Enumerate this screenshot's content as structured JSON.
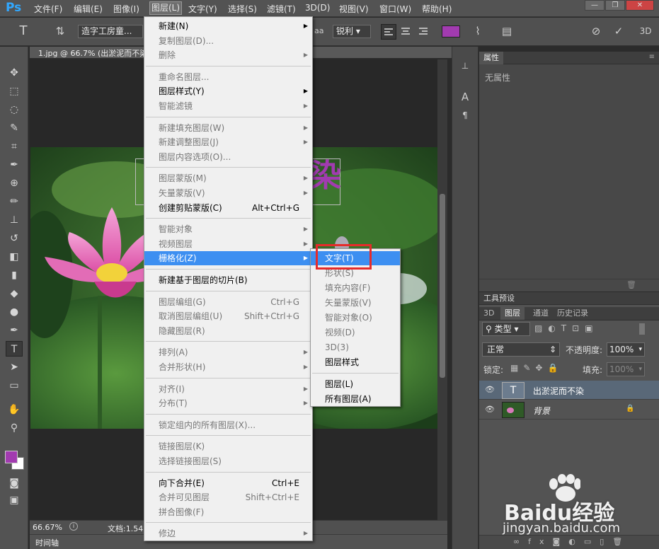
{
  "app": {
    "logo": "Ps"
  },
  "menubar": {
    "items": [
      "文件(F)",
      "编辑(E)",
      "图像(I)",
      "图层(L)",
      "文字(Y)",
      "选择(S)",
      "滤镜(T)",
      "3D(D)",
      "视图(V)",
      "窗口(W)",
      "帮助(H)"
    ],
    "active_index": 3
  },
  "window_controls": {
    "minimize": "—",
    "restore": "❐",
    "close": "✕"
  },
  "options": {
    "tool_glyph": "T",
    "font_family": "造字工房童...",
    "font_size_unit": "aa",
    "antialias": "锐利",
    "text_color": "#a23bb0",
    "d3": "3D"
  },
  "document": {
    "tab_title": "1.jpg @ 66.7% (出淤泥而不染",
    "zoom": "66.67%",
    "doc_info": "文档:1.54",
    "text_overlay": "出淤泥而不染"
  },
  "timeline": {
    "label": "时间轴"
  },
  "toolbar": {
    "tools": [
      "move-tool",
      "marquee-tool",
      "lasso-tool",
      "quick-select-tool",
      "crop-tool",
      "eyedropper-tool",
      "healing-tool",
      "brush-tool",
      "stamp-tool",
      "history-brush-tool",
      "eraser-tool",
      "gradient-tool",
      "blur-tool",
      "dodge-tool",
      "pen-tool",
      "type-tool",
      "path-select-tool",
      "shape-tool",
      "hand-tool",
      "zoom-tool"
    ],
    "foreground": "#a23bb0",
    "background": "#ffffff"
  },
  "properties": {
    "tab": "属性",
    "empty_text": "无属性"
  },
  "tool_presets": {
    "tab": "工具预设"
  },
  "layers_panel": {
    "tabs": [
      "3D",
      "图层",
      "通道",
      "历史记录"
    ],
    "filter_kind": "类型",
    "blend_mode": "正常",
    "opacity_label": "不透明度:",
    "opacity": "100%",
    "lock_label": "锁定:",
    "fill_label": "填充:",
    "fill": "100%",
    "layers": [
      {
        "name": "出淤泥而不染",
        "type": "text",
        "selected": true
      },
      {
        "name": "背景",
        "type": "image",
        "locked": true
      }
    ]
  },
  "layer_menu": {
    "items": [
      {
        "label": "新建(N)",
        "enabled": true,
        "submenu": true
      },
      {
        "label": "复制图层(D)...",
        "enabled": false
      },
      {
        "label": "删除",
        "enabled": false,
        "submenu": true
      },
      {
        "sep": true
      },
      {
        "label": "重命名图层...",
        "enabled": false
      },
      {
        "label": "图层样式(Y)",
        "enabled": true,
        "submenu": true
      },
      {
        "label": "智能滤镜",
        "enabled": false,
        "submenu": true
      },
      {
        "sep": true
      },
      {
        "label": "新建填充图层(W)",
        "enabled": false,
        "submenu": true
      },
      {
        "label": "新建调整图层(J)",
        "enabled": false,
        "submenu": true
      },
      {
        "label": "图层内容选项(O)...",
        "enabled": false
      },
      {
        "sep": true
      },
      {
        "label": "图层蒙版(M)",
        "enabled": false,
        "submenu": true
      },
      {
        "label": "矢量蒙版(V)",
        "enabled": false,
        "submenu": true
      },
      {
        "label": "创建剪贴蒙版(C)",
        "enabled": true,
        "shortcut": "Alt+Ctrl+G"
      },
      {
        "sep": true
      },
      {
        "label": "智能对象",
        "enabled": false,
        "submenu": true
      },
      {
        "label": "视频图层",
        "enabled": false,
        "submenu": true
      },
      {
        "label": "栅格化(Z)",
        "enabled": true,
        "submenu": true,
        "highlight": true
      },
      {
        "sep": true
      },
      {
        "label": "新建基于图层的切片(B)",
        "enabled": true
      },
      {
        "sep": true
      },
      {
        "label": "图层编组(G)",
        "enabled": false,
        "shortcut": "Ctrl+G"
      },
      {
        "label": "取消图层编组(U)",
        "enabled": false,
        "shortcut": "Shift+Ctrl+G"
      },
      {
        "label": "隐藏图层(R)",
        "enabled": false
      },
      {
        "sep": true
      },
      {
        "label": "排列(A)",
        "enabled": false,
        "submenu": true
      },
      {
        "label": "合并形状(H)",
        "enabled": false,
        "submenu": true
      },
      {
        "sep": true
      },
      {
        "label": "对齐(I)",
        "enabled": false,
        "submenu": true
      },
      {
        "label": "分布(T)",
        "enabled": false,
        "submenu": true
      },
      {
        "sep": true
      },
      {
        "label": "锁定组内的所有图层(X)...",
        "enabled": false
      },
      {
        "sep": true
      },
      {
        "label": "链接图层(K)",
        "enabled": false
      },
      {
        "label": "选择链接图层(S)",
        "enabled": false
      },
      {
        "sep": true
      },
      {
        "label": "向下合并(E)",
        "enabled": true,
        "shortcut": "Ctrl+E"
      },
      {
        "label": "合并可见图层",
        "enabled": false,
        "shortcut": "Shift+Ctrl+E"
      },
      {
        "label": "拼合图像(F)",
        "enabled": false
      },
      {
        "sep": true
      },
      {
        "label": "修边",
        "enabled": false,
        "submenu": true
      }
    ]
  },
  "rasterize_menu": {
    "items": [
      {
        "label": "文字(T)",
        "enabled": true,
        "highlight": true,
        "boxed": true
      },
      {
        "label": "形状(S)",
        "enabled": false
      },
      {
        "label": "填充内容(F)",
        "enabled": false
      },
      {
        "label": "矢量蒙版(V)",
        "enabled": false
      },
      {
        "label": "智能对象(O)",
        "enabled": false
      },
      {
        "label": "视频(D)",
        "enabled": false
      },
      {
        "label": "3D(3)",
        "enabled": false
      },
      {
        "label": "图层样式",
        "enabled": true
      },
      {
        "sep": true
      },
      {
        "label": "图层(L)",
        "enabled": true
      },
      {
        "label": "所有图层(A)",
        "enabled": true
      }
    ]
  },
  "highlight_color": "#e62b2b",
  "watermark": {
    "brand": "Baidu经验",
    "url": "jingyan.baidu.com"
  }
}
